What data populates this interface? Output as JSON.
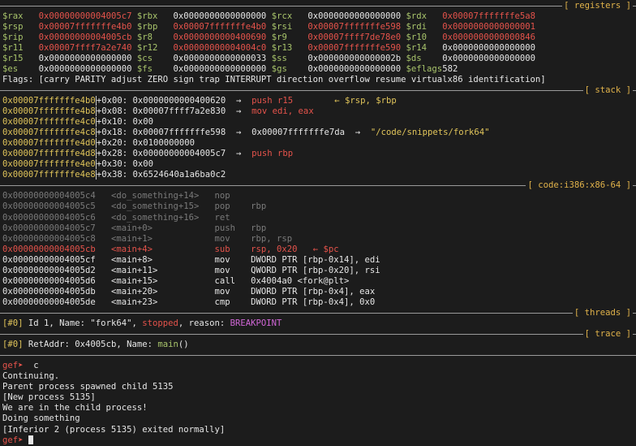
{
  "sections": {
    "registers": "[ registers ]",
    "stack": "[ stack ]",
    "code": "[ code:i386:x86-64 ]",
    "threads": "[ threads ]",
    "trace": "[ trace ]"
  },
  "registers": [
    [
      {
        "n": "$rax",
        "v": "0x00000000004005c7",
        "c": "red"
      },
      {
        "n": "$rbx",
        "v": "0x0000000000000000",
        "c": "wht"
      },
      {
        "n": "$rcx",
        "v": "0x0000000000000000",
        "c": "wht"
      },
      {
        "n": "$rdx",
        "v": "0x00007fffffffe5a8",
        "c": "red"
      }
    ],
    [
      {
        "n": "$rsp",
        "v": "0x00007fffffffe4b0",
        "c": "red"
      },
      {
        "n": "$rbp",
        "v": "0x00007fffffffe4b0",
        "c": "red"
      },
      {
        "n": "$rsi",
        "v": "0x00007fffffffe598",
        "c": "red"
      },
      {
        "n": "$rdi",
        "v": "0x0000000000000001",
        "c": "red"
      }
    ],
    [
      {
        "n": "$rip",
        "v": "0x00000000004005cb",
        "c": "red"
      },
      {
        "n": "$r8",
        "v": "0x0000000000400690",
        "c": "red"
      },
      {
        "n": "$r9",
        "v": "0x00007ffff7de78e0",
        "c": "red"
      },
      {
        "n": "$r10",
        "v": "0x0000000000000846",
        "c": "red"
      }
    ],
    [
      {
        "n": "$r11",
        "v": "0x00007ffff7a2e740",
        "c": "red"
      },
      {
        "n": "$r12",
        "v": "0x00000000004004c0",
        "c": "red"
      },
      {
        "n": "$r13",
        "v": "0x00007fffffffe590",
        "c": "red"
      },
      {
        "n": "$r14",
        "v": "0x0000000000000000",
        "c": "wht"
      }
    ],
    [
      {
        "n": "$r15",
        "v": "0x0000000000000000",
        "c": "wht"
      },
      {
        "n": "$cs",
        "v": "0x0000000000000033",
        "c": "wht"
      },
      {
        "n": "$ss",
        "v": "0x000000000000002b",
        "c": "wht"
      },
      {
        "n": "$ds",
        "v": "0x0000000000000000",
        "c": "wht"
      }
    ],
    [
      {
        "n": "$es",
        "v": "0x0000000000000000",
        "c": "wht"
      },
      {
        "n": "$fs",
        "v": "0x0000000000000000",
        "c": "wht"
      },
      {
        "n": "$gs",
        "v": "0x0000000000000000",
        "c": "wht"
      },
      {
        "n": "$eflags",
        "v": "582",
        "c": "wht"
      }
    ]
  ],
  "flags_line": "Flags: [carry PARITY adjust ZERO sign trap INTERRUPT direction overflow resume virtualx86 identification]",
  "stack": [
    {
      "addr": "0x00007fffffffe4b0",
      "off": "+0x00: 0x0000000000400620",
      "rest": [
        {
          "t": "  →  ",
          "c": "wht"
        },
        {
          "t": "push r15",
          "c": "red"
        },
        {
          "t": "        ← $rsp, $rbp",
          "c": "yel"
        }
      ]
    },
    {
      "addr": "0x00007fffffffe4b8",
      "off": "+0x08: 0x00007ffff7a2e830",
      "rest": [
        {
          "t": "  →  ",
          "c": "wht"
        },
        {
          "t": "mov edi, eax",
          "c": "red"
        }
      ]
    },
    {
      "addr": "0x00007fffffffe4c0",
      "off": "+0x10: 0x00",
      "rest": []
    },
    {
      "addr": "0x00007fffffffe4c8",
      "off": "+0x18: 0x00007fffffffe598",
      "rest": [
        {
          "t": "  →  0x00007fffffffe7da  →  ",
          "c": "wht"
        },
        {
          "t": "\"/code/snippets/fork64\"",
          "c": "yel"
        }
      ]
    },
    {
      "addr": "0x00007fffffffe4d0",
      "off": "+0x20: 0x0100000000",
      "rest": []
    },
    {
      "addr": "0x00007fffffffe4d8",
      "off": "+0x28: 0x00000000004005c7",
      "rest": [
        {
          "t": "  →  ",
          "c": "wht"
        },
        {
          "t": "push rbp",
          "c": "red"
        }
      ]
    },
    {
      "addr": "0x00007fffffffe4e0",
      "off": "+0x30: 0x00",
      "rest": []
    },
    {
      "addr": "0x00007fffffffe4e8",
      "off": "+0x38: 0x6524640a1a6ba0c2",
      "rest": []
    }
  ],
  "code": [
    {
      "addr": "0x00000000004005c4",
      "sym": "<do_something+14>",
      "ins": "nop",
      "c": "gry"
    },
    {
      "addr": "0x00000000004005c5",
      "sym": "<do_something+15>",
      "ins": "pop    rbp",
      "c": "gry"
    },
    {
      "addr": "0x00000000004005c6",
      "sym": "<do_something+16>",
      "ins": "ret",
      "c": "gry"
    },
    {
      "addr": "0x00000000004005c7",
      "sym": "<main+0>",
      "ins": "push   rbp",
      "c": "gry"
    },
    {
      "addr": "0x00000000004005c8",
      "sym": "<main+1>",
      "ins": "mov    rbp, rsp",
      "c": "gry"
    },
    {
      "addr": "0x00000000004005cb",
      "sym": "<main+4>",
      "ins": "sub    rsp, 0x20",
      "c": "red",
      "mark": "   ← $pc"
    },
    {
      "addr": "0x00000000004005cf",
      "sym": "<main+8>",
      "ins": "mov    DWORD PTR [rbp-0x14], edi",
      "c": "wht"
    },
    {
      "addr": "0x00000000004005d2",
      "sym": "<main+11>",
      "ins": "mov    QWORD PTR [rbp-0x20], rsi",
      "c": "wht"
    },
    {
      "addr": "0x00000000004005d6",
      "sym": "<main+15>",
      "ins": "call   0x4004a0 <fork@plt>",
      "c": "wht"
    },
    {
      "addr": "0x00000000004005db",
      "sym": "<main+20>",
      "ins": "mov    DWORD PTR [rbp-0x4], eax",
      "c": "wht"
    },
    {
      "addr": "0x00000000004005de",
      "sym": "<main+23>",
      "ins": "cmp    DWORD PTR [rbp-0x4], 0x0",
      "c": "wht"
    }
  ],
  "thread": {
    "idx": "[#0]",
    "text": " Id 1, Name: \"fork64\", ",
    "state": "stopped",
    "mid": ", reason: ",
    "reason": "BREAKPOINT"
  },
  "trace": {
    "idx": "[#0]",
    "text": " RetAddr: 0x4005cb, Name: ",
    "fn": "main",
    "tail": "()"
  },
  "console": {
    "prompt": "gef➤",
    "command": "  c",
    "output": [
      "Continuing.",
      "Parent process spawned child 5135",
      "[New process 5135]",
      "We are in the child process!",
      "Doing something",
      "[Inferior 2 (process 5135) exited normally]"
    ]
  }
}
